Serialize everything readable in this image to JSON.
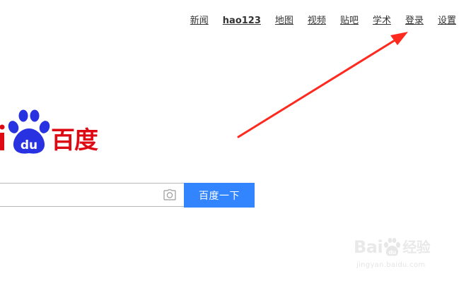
{
  "nav": {
    "items": [
      {
        "label": "新闻",
        "bold": false
      },
      {
        "label": "hao123",
        "bold": true
      },
      {
        "label": "地图",
        "bold": false
      },
      {
        "label": "视频",
        "bold": false
      },
      {
        "label": "贴吧",
        "bold": false
      },
      {
        "label": "学术",
        "bold": false
      },
      {
        "label": "登录",
        "bold": false
      },
      {
        "label": "设置",
        "bold": false
      }
    ]
  },
  "logo": {
    "text_left": "i",
    "text_paw": "du",
    "text_right": "百度"
  },
  "search": {
    "value": "",
    "placeholder": "",
    "button_label": "百度一下"
  },
  "watermark": {
    "brand": "Bai",
    "brand_paw": "du",
    "product": "经验",
    "url": "jingyan.baidu.com"
  },
  "colors": {
    "brand_red": "#de0a13",
    "brand_blue": "#2932e1",
    "button_blue": "#3385ff",
    "annotation_red": "#ff2a1f"
  }
}
